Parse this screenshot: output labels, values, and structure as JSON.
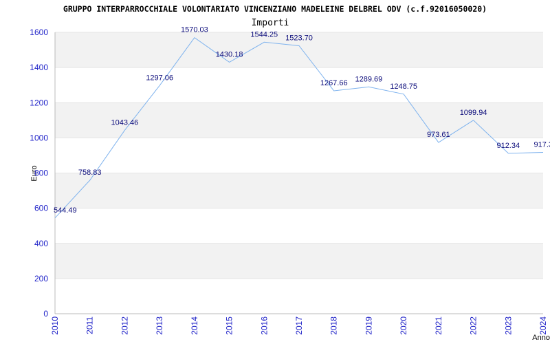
{
  "chart_data": {
    "type": "line",
    "title": "GRUPPO INTERPARROCCHIALE VOLONTARIATO VINCENZIANO MADELEINE DELBREL ODV (c.f.92016050020)",
    "subtitle": "Importi",
    "xlabel": "Anno",
    "ylabel": "Euro",
    "categories": [
      "2010",
      "2011",
      "2012",
      "2013",
      "2014",
      "2015",
      "2016",
      "2017",
      "2018",
      "2019",
      "2020",
      "2021",
      "2022",
      "2023",
      "2024"
    ],
    "values": [
      544.49,
      758.83,
      1043.46,
      1297.06,
      1570.03,
      1430.18,
      1544.25,
      1523.7,
      1267.66,
      1289.69,
      1248.75,
      973.61,
      1099.94,
      912.34,
      917.3
    ],
    "value_labels": [
      "544.49",
      "758.83",
      "1043.46",
      "1297.06",
      "1570.03",
      "1430.18",
      "1544.25",
      "1523.70",
      "1267.66",
      "1289.69",
      "1248.75",
      "973.61",
      "1099.94",
      "912.34",
      "917.3"
    ],
    "yticks": [
      "0",
      "200",
      "400",
      "600",
      "800",
      "1000",
      "1200",
      "1400",
      "1600"
    ],
    "ylim": [
      0,
      1600
    ],
    "grid": "horizontal bands",
    "colors": {
      "line": "#7fb3ee",
      "band": "#f2f2f2",
      "tick_text": "#1f22c8",
      "label_text": "#0a0a7a"
    }
  }
}
